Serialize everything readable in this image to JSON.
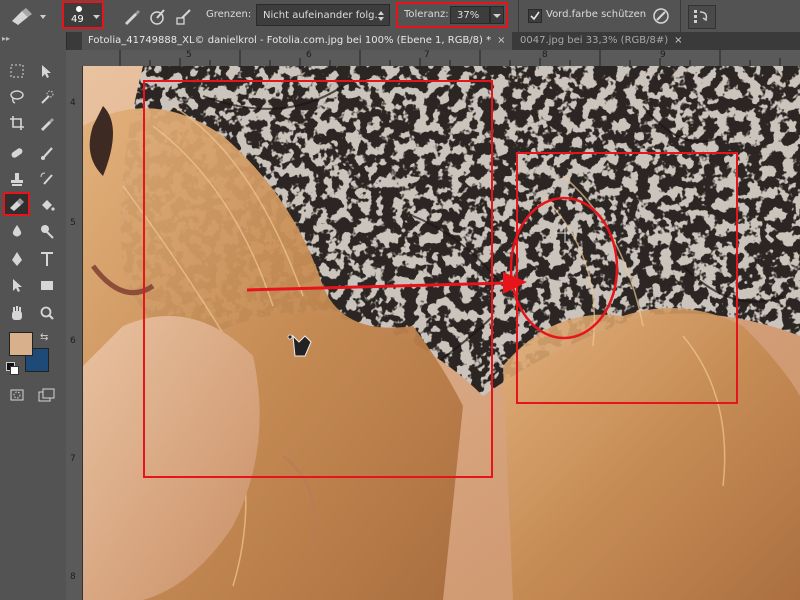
{
  "options_bar": {
    "brush_size": "49",
    "limits_label": "Grenzen:",
    "limits_value": "Nicht aufeinander folg.",
    "tolerance_label": "Toleranz:",
    "tolerance_value": "37%",
    "protect_fg_label": "Vord.farbe schützen",
    "protect_fg_checked": true
  },
  "tabs": [
    {
      "label": "Fotolia_41749888_XL© danielkrol - Fotolia.com.jpg bei 100% (Ebene 1, RGB/8) *",
      "close": "×"
    },
    {
      "label": "0047.jpg bei 33,3% (RGB/8#)",
      "close": "×"
    }
  ],
  "ruler_h": [
    "5",
    "6",
    "7",
    "8",
    "9"
  ],
  "ruler_v": [
    "4",
    "5",
    "6",
    "7",
    "8"
  ],
  "colors": {
    "foreground": "#d8b18c",
    "background": "#1e4a78",
    "highlight": "#e8141c"
  }
}
